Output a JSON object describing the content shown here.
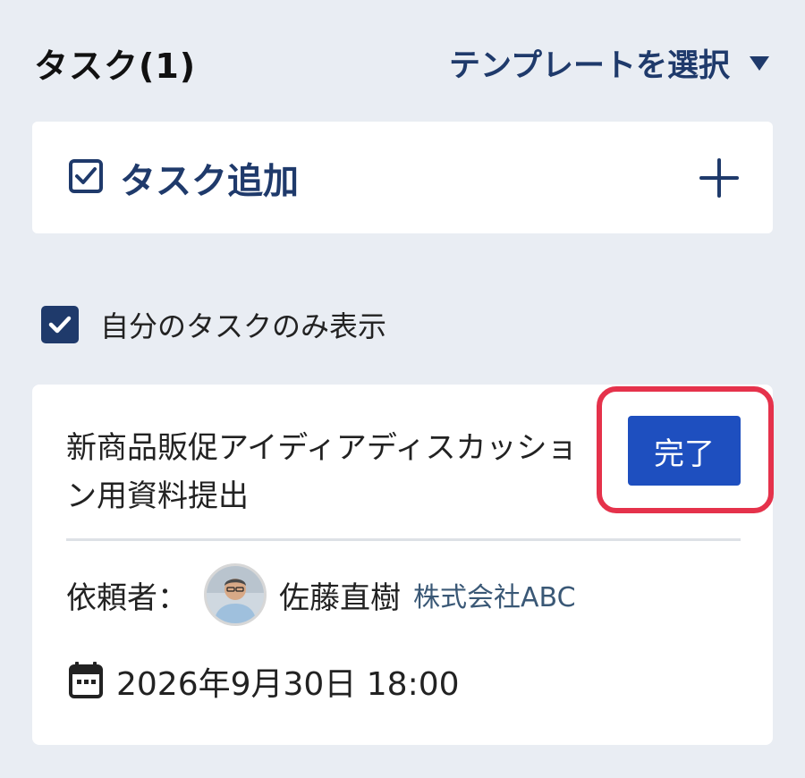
{
  "header": {
    "title": "タスク(1)",
    "template_select_label": "テンプレートを選択"
  },
  "add_task": {
    "label": "タスク追加"
  },
  "filter": {
    "label": "自分のタスクのみ表示",
    "checked": true
  },
  "task": {
    "title": "新商品販促アイディアディスカッション用資料提出",
    "complete_label": "完了",
    "requester_label": "依頼者：",
    "requester_name": "佐藤直樹",
    "requester_company": "株式会社ABC",
    "due_date": "2026年9月30日 18:00"
  },
  "colors": {
    "background": "#e9edf3",
    "navy": "#1f3a6b",
    "button_blue": "#1e4fbf",
    "highlight_red": "#e5324b"
  },
  "icons": {
    "template_caret": "caret-down-icon",
    "add_task_icon": "checkbox-check-icon",
    "add_plus": "plus-icon",
    "calendar": "calendar-icon"
  }
}
